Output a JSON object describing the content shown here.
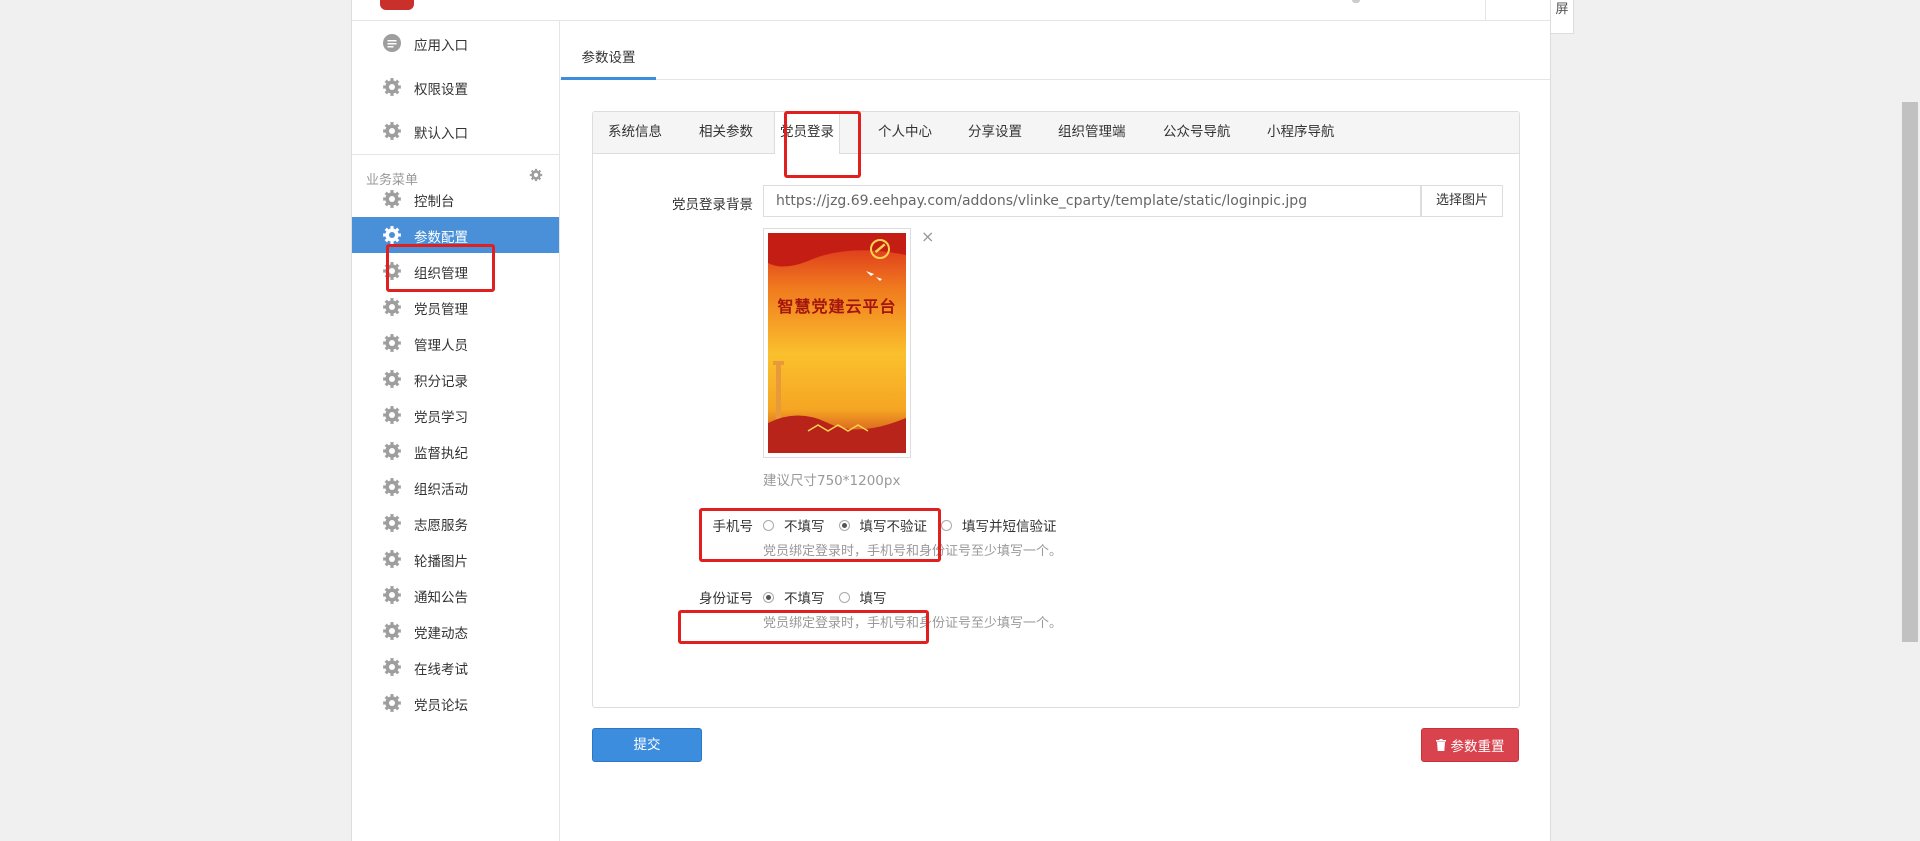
{
  "sidebar": {
    "top_items": [
      {
        "label": "应用入口",
        "icon": "chat-icon"
      },
      {
        "label": "权限设置",
        "icon": "gear-icon"
      },
      {
        "label": "默认入口",
        "icon": "gear-icon"
      }
    ],
    "group_title": "业务菜单",
    "items": [
      {
        "label": "控制台"
      },
      {
        "label": "参数配置",
        "active": true
      },
      {
        "label": "组织管理"
      },
      {
        "label": "党员管理"
      },
      {
        "label": "管理人员"
      },
      {
        "label": "积分记录"
      },
      {
        "label": "党员学习"
      },
      {
        "label": "监督执纪"
      },
      {
        "label": "组织活动"
      },
      {
        "label": "志愿服务"
      },
      {
        "label": "轮播图片"
      },
      {
        "label": "通知公告"
      },
      {
        "label": "党建动态"
      },
      {
        "label": "在线考试"
      },
      {
        "label": "党员论坛"
      }
    ]
  },
  "header": {
    "tab": "参数设置"
  },
  "tabs": [
    "系统信息",
    "相关参数",
    "党员登录",
    "个人中心",
    "分享设置",
    "组织管理端",
    "公众号导航",
    "小程序导航"
  ],
  "active_tab": "党员登录",
  "form": {
    "bg_label": "党员登录背景",
    "bg_url": "https://jzg.69.eehpay.com/addons/vlinke_cparty/template/static/loginpic.jpg",
    "pick_button": "选择图片",
    "thumb_text": "智慧党建云平台",
    "close_glyph": "×",
    "size_hint": "建议尺寸750*1200px",
    "phone": {
      "label": "手机号",
      "options": [
        "不填写",
        "填写不验证",
        "填写并短信验证"
      ],
      "selected": 1,
      "help": "党员绑定登录时，手机号和身份证号至少填写一个。"
    },
    "idcard": {
      "label": "身份证号",
      "options": [
        "不填写",
        "填写"
      ],
      "selected": 0,
      "help": "党员绑定登录时，手机号和身份证号至少填写一个。"
    }
  },
  "actions": {
    "submit": "提交",
    "reset": "参数重置"
  },
  "right_panel_text": "屏",
  "colors": {
    "primary": "#3c8dde",
    "danger": "#d9434e",
    "highlight": "#e01f1f",
    "active_nav": "#4a90d9"
  }
}
